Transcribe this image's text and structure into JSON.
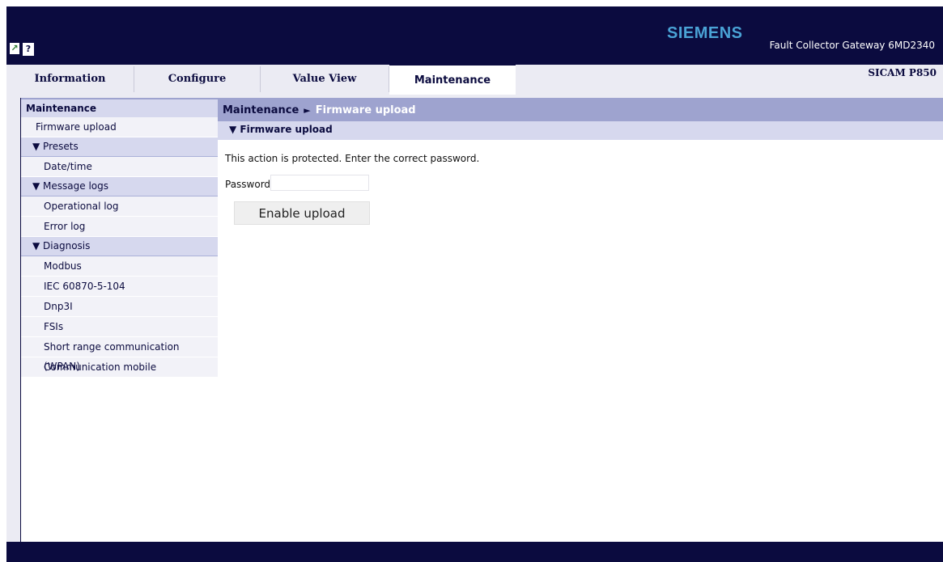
{
  "header": {
    "brand": "SIEMENS",
    "product": "Fault Collector Gateway 6MD2340",
    "icons": [
      "exit-icon",
      "help-icon"
    ],
    "help_glyph": "?"
  },
  "tabs": [
    {
      "label": "Information",
      "active": false
    },
    {
      "label": "Configure",
      "active": false
    },
    {
      "label": "Value View",
      "active": false
    },
    {
      "label": "Maintenance",
      "active": true
    }
  ],
  "device_label": "SICAM P850",
  "sidebar": {
    "title": "Maintenance",
    "items": [
      {
        "label": "Firmware upload"
      },
      {
        "group": "▼ Presets"
      },
      {
        "label": "Date/time"
      },
      {
        "group": "▼ Message logs"
      },
      {
        "label": "Operational log"
      },
      {
        "label": "Error log"
      },
      {
        "group": "▼ Diagnosis"
      },
      {
        "label": "Modbus"
      },
      {
        "label": "IEC 60870-5-104"
      },
      {
        "label": "Dnp3I"
      },
      {
        "label": "FSIs"
      },
      {
        "label": "Short range communication (WPAN)"
      },
      {
        "label": "Communication mobile"
      }
    ]
  },
  "main": {
    "breadcrumb": {
      "root": "Maintenance",
      "arrow": "►",
      "current": "Firmware upload"
    },
    "section": "▼ Firmware upload",
    "message": "This action is protected. Enter the correct password.",
    "password_label": "Password",
    "password_value": "",
    "button": "Enable upload"
  },
  "colors": {
    "header_bg": "#0b0b3f",
    "brand": "#4aa3d6",
    "breadcrumb_bg": "#9ea3cf",
    "section_bg": "#d6d8ee"
  }
}
